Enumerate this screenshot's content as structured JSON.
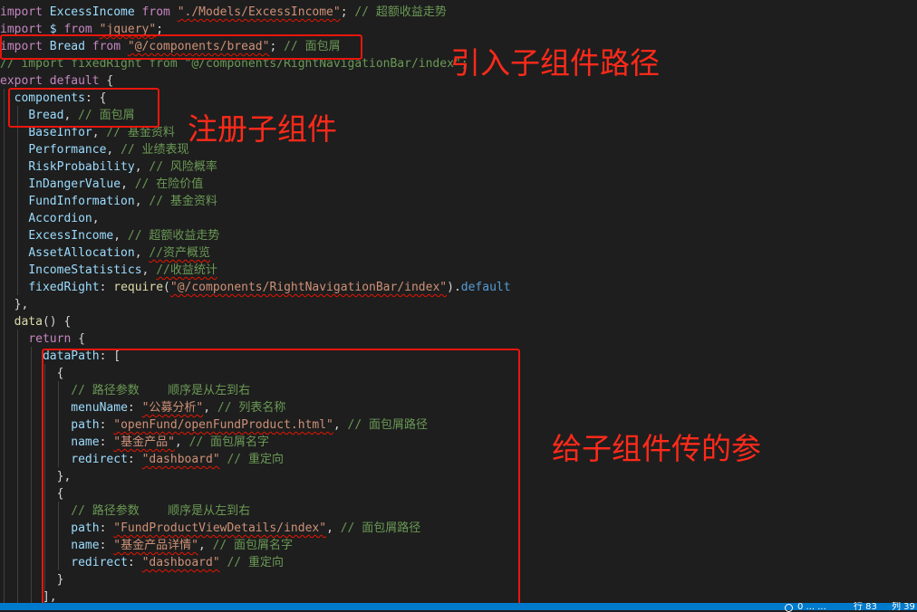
{
  "editor": {
    "lines": [
      [
        [
          "import",
          "kw"
        ],
        [
          " ExcessIncome ",
          "var"
        ],
        [
          "from",
          "kw"
        ],
        [
          " ",
          "pn"
        ],
        [
          "\"./Models/ExcessIncome\"",
          "str sq"
        ],
        [
          "; ",
          "pn"
        ],
        [
          "// 超额收益走势",
          "cmt"
        ]
      ],
      [
        [
          "import",
          "kw"
        ],
        [
          " $ ",
          "var"
        ],
        [
          "from",
          "kw"
        ],
        [
          " ",
          "pn"
        ],
        [
          "\"jquery\"",
          "str sq"
        ],
        [
          ";",
          "pn"
        ]
      ],
      [
        [
          "import",
          "kw"
        ],
        [
          " Bread ",
          "var"
        ],
        [
          "from",
          "kw"
        ],
        [
          " ",
          "pn"
        ],
        [
          "\"@/components/bread\"",
          "str sq"
        ],
        [
          "; ",
          "pn"
        ],
        [
          "// 面包屑",
          "cmt"
        ]
      ],
      [
        [
          "// import fixedRight from \"@/components/RightNavigationBar/index\";",
          "cmt"
        ]
      ],
      [
        [
          "export",
          "kw"
        ],
        [
          " ",
          "pn"
        ],
        [
          "default",
          "kw"
        ],
        [
          " {",
          "pn"
        ]
      ],
      [
        [
          "  ",
          "pn"
        ],
        [
          "components",
          "var"
        ],
        [
          ": {",
          "pn"
        ]
      ],
      [
        [
          "    ",
          "pn"
        ],
        [
          "Bread",
          "var"
        ],
        [
          ", ",
          "pn"
        ],
        [
          "// 面包屑",
          "cmt"
        ]
      ],
      [
        [
          "    ",
          "pn"
        ],
        [
          "BaseInfor",
          "var"
        ],
        [
          ", ",
          "pn"
        ],
        [
          "// 基金资料",
          "cmt"
        ]
      ],
      [
        [
          "    ",
          "pn"
        ],
        [
          "Performance",
          "var"
        ],
        [
          ", ",
          "pn"
        ],
        [
          "// 业绩表现",
          "cmt"
        ]
      ],
      [
        [
          "    ",
          "pn"
        ],
        [
          "RiskProbability",
          "var"
        ],
        [
          ", ",
          "pn"
        ],
        [
          "// 风险概率",
          "cmt"
        ]
      ],
      [
        [
          "    ",
          "pn"
        ],
        [
          "InDangerValue",
          "var"
        ],
        [
          ", ",
          "pn"
        ],
        [
          "// 在险价值",
          "cmt"
        ]
      ],
      [
        [
          "    ",
          "pn"
        ],
        [
          "FundInformation",
          "var"
        ],
        [
          ", ",
          "pn"
        ],
        [
          "// 基金资料",
          "cmt"
        ]
      ],
      [
        [
          "    ",
          "pn"
        ],
        [
          "Accordion",
          "var"
        ],
        [
          ",",
          "pn"
        ]
      ],
      [
        [
          "    ",
          "pn"
        ],
        [
          "ExcessIncome",
          "var"
        ],
        [
          ", ",
          "pn"
        ],
        [
          "// 超额收益走势",
          "cmt"
        ]
      ],
      [
        [
          "    ",
          "pn"
        ],
        [
          "AssetAllocation",
          "var"
        ],
        [
          ", ",
          "pn"
        ],
        [
          "//资产概览",
          "cmt sq"
        ]
      ],
      [
        [
          "    ",
          "pn"
        ],
        [
          "IncomeStatistics",
          "var"
        ],
        [
          ", ",
          "pn"
        ],
        [
          "//收益统计",
          "cmt sq"
        ]
      ],
      [
        [
          "    ",
          "pn"
        ],
        [
          "fixedRight",
          "var"
        ],
        [
          ": ",
          "pn"
        ],
        [
          "require",
          "fn"
        ],
        [
          "(",
          "pn"
        ],
        [
          "\"@/components/RightNavigationBar/index\"",
          "str sq"
        ],
        [
          ").",
          "pn"
        ],
        [
          "default",
          "kb"
        ]
      ],
      [
        [
          "  },",
          "pn"
        ]
      ],
      [
        [
          "  ",
          "pn"
        ],
        [
          "data",
          "fn"
        ],
        [
          "() {",
          "pn"
        ]
      ],
      [
        [
          "    ",
          "pn"
        ],
        [
          "return",
          "kw"
        ],
        [
          " {",
          "pn"
        ]
      ],
      [
        [
          "      ",
          "pn"
        ],
        [
          "dataPath",
          "var"
        ],
        [
          ": [",
          "pn"
        ]
      ],
      [
        [
          "        {",
          "pn"
        ]
      ],
      [
        [
          "          ",
          "pn"
        ],
        [
          "// 路径参数    顺序是从左到右",
          "cmt"
        ]
      ],
      [
        [
          "          ",
          "pn"
        ],
        [
          "menuName",
          "var"
        ],
        [
          ": ",
          "pn"
        ],
        [
          "\"公募分析\"",
          "str sq"
        ],
        [
          ", ",
          "pn"
        ],
        [
          "// 列表名称",
          "cmt"
        ]
      ],
      [
        [
          "          ",
          "pn"
        ],
        [
          "path",
          "var"
        ],
        [
          ": ",
          "pn"
        ],
        [
          "\"openFund/openFundProduct.html\"",
          "str sq"
        ],
        [
          ", ",
          "pn"
        ],
        [
          "// 面包屑路径",
          "cmt"
        ]
      ],
      [
        [
          "          ",
          "pn"
        ],
        [
          "name",
          "var"
        ],
        [
          ": ",
          "pn"
        ],
        [
          "\"基金产品\"",
          "str sq"
        ],
        [
          ", ",
          "pn"
        ],
        [
          "// 面包屑名字",
          "cmt"
        ]
      ],
      [
        [
          "          ",
          "pn"
        ],
        [
          "redirect",
          "var"
        ],
        [
          ": ",
          "pn"
        ],
        [
          "\"dashboard\"",
          "str sq"
        ],
        [
          " ",
          "pn"
        ],
        [
          "// 重定向",
          "cmt"
        ]
      ],
      [
        [
          "        },",
          "pn"
        ]
      ],
      [
        [
          "        {",
          "pn"
        ]
      ],
      [
        [
          "          ",
          "pn"
        ],
        [
          "// 路径参数    顺序是从左到右",
          "cmt"
        ]
      ],
      [
        [
          "          ",
          "pn"
        ],
        [
          "path",
          "var"
        ],
        [
          ": ",
          "pn"
        ],
        [
          "\"FundProductViewDetails/index\"",
          "str sq"
        ],
        [
          ", ",
          "pn"
        ],
        [
          "// 面包屑路径",
          "cmt"
        ]
      ],
      [
        [
          "          ",
          "pn"
        ],
        [
          "name",
          "var"
        ],
        [
          ": ",
          "pn"
        ],
        [
          "\"基金产品详情\"",
          "str sq"
        ],
        [
          ", ",
          "pn"
        ],
        [
          "// 面包屑名字",
          "cmt"
        ]
      ],
      [
        [
          "          ",
          "pn"
        ],
        [
          "redirect",
          "var"
        ],
        [
          ": ",
          "pn"
        ],
        [
          "\"dashboard\"",
          "str sq"
        ],
        [
          " ",
          "pn"
        ],
        [
          "// 重定向",
          "cmt"
        ]
      ],
      [
        [
          "        }",
          "pn"
        ]
      ],
      [
        [
          "      ],",
          "pn"
        ]
      ]
    ]
  },
  "annotations": {
    "import_child_path": "引入子组件路径",
    "register_child": "注册子组件",
    "pass_params_to_child": "给子组件传的参"
  },
  "statusbar": {
    "text_left": "0 ... ...",
    "text_mid": "行 83",
    "text_right": "列 39"
  },
  "colors": {
    "annotation_red": "#e8160c",
    "statusbar_blue": "#007acc"
  }
}
